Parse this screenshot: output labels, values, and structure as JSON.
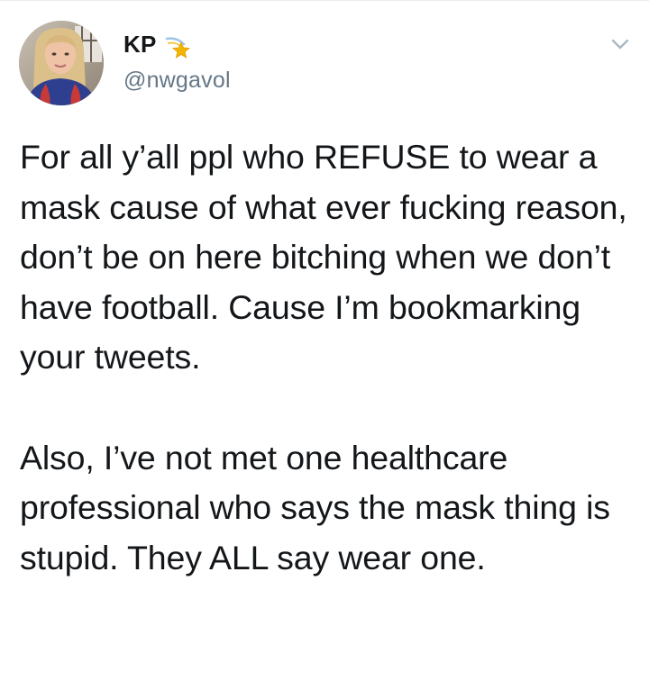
{
  "tweet": {
    "display_name": "KP",
    "name_emoji_icon": "shooting-star-icon",
    "handle": "@nwgavol",
    "more_icon": "chevron-down-icon",
    "paragraph_1": "For all y’all ppl who REFUSE to wear a mask cause of what ever fucking reason, don’t be on here bitching when we don’t have football. Cause I’m bookmarking your tweets.",
    "paragraph_2": "Also, I’ve not met one healthcare professional who says the mask thing is stupid. They ALL say wear one."
  },
  "colors": {
    "text": "#14171a",
    "secondary_text": "#657786",
    "divider": "#e6ecf0",
    "chevron": "#aab8c2",
    "star": "#f4b400"
  }
}
